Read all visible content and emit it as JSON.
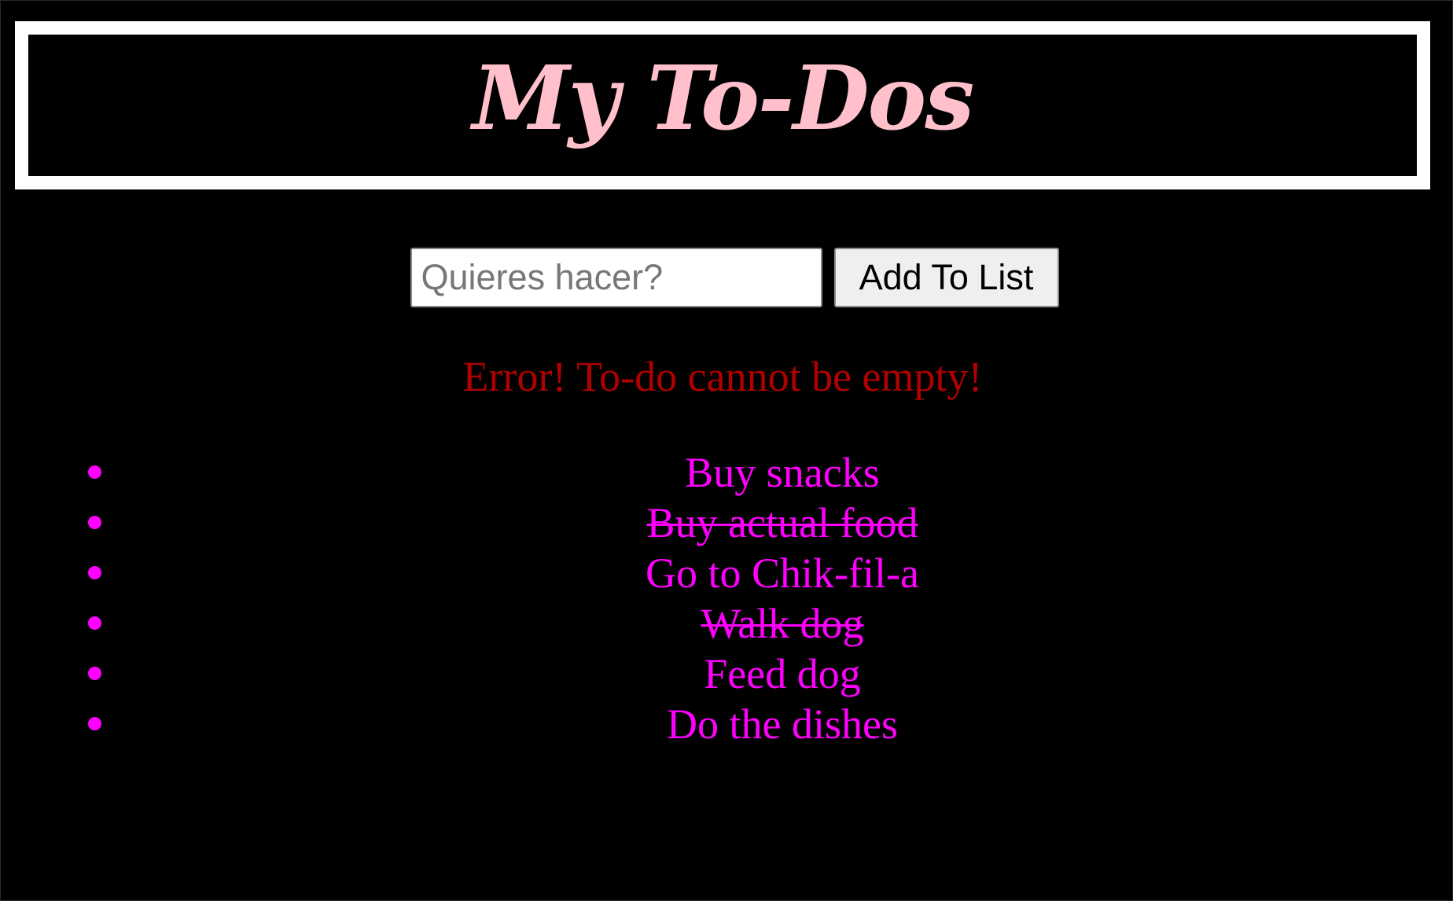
{
  "header": {
    "title": "My To-Dos",
    "title_color": "#ffc0cb",
    "frame_color": "#ffffff"
  },
  "form": {
    "input_placeholder": "Quieres hacer?",
    "input_value": "",
    "add_button_label": "Add To List"
  },
  "error": {
    "message": "Error! To-do cannot be empty!",
    "color": "#b00000"
  },
  "todos": {
    "color": "#ff00ff",
    "items": [
      {
        "text": "Buy snacks",
        "completed": false
      },
      {
        "text": "Buy actual food",
        "completed": true
      },
      {
        "text": "Go to Chik-fil-a",
        "completed": false
      },
      {
        "text": "Walk dog",
        "completed": true
      },
      {
        "text": "Feed dog",
        "completed": false
      },
      {
        "text": "Do the dishes",
        "completed": false
      }
    ]
  }
}
